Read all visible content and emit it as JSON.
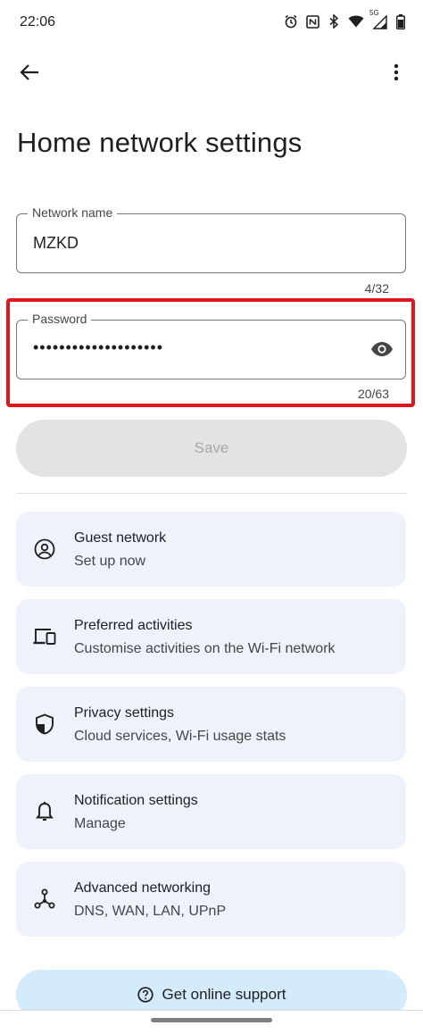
{
  "status_bar": {
    "time": "22:06",
    "icons": [
      "alarm-icon",
      "nfc-icon",
      "bluetooth-icon",
      "wifi-icon",
      "signal-icon",
      "battery-icon"
    ],
    "network_type": "5G"
  },
  "top_bar": {
    "back_icon": "arrow-back-icon",
    "more_icon": "more-vert-icon"
  },
  "page": {
    "title": "Home network settings"
  },
  "network_name": {
    "label": "Network name",
    "value": "MZKD",
    "counter": "4/32"
  },
  "password": {
    "label": "Password",
    "value": "••••••••••••••••••••",
    "counter": "20/63",
    "toggle_icon": "eye-icon"
  },
  "save": {
    "label": "Save"
  },
  "cards": [
    {
      "icon": "account-circle-icon",
      "title": "Guest network",
      "subtitle": "Set up now"
    },
    {
      "icon": "devices-icon",
      "title": "Preferred activities",
      "subtitle": "Customise activities on the Wi-Fi network"
    },
    {
      "icon": "shield-icon",
      "title": "Privacy settings",
      "subtitle": "Cloud services, Wi-Fi usage stats"
    },
    {
      "icon": "bell-icon",
      "title": "Notification settings",
      "subtitle": "Manage"
    },
    {
      "icon": "network-hub-icon",
      "title": "Advanced networking",
      "subtitle": "DNS, WAN, LAN, UPnP"
    }
  ],
  "support": {
    "icon": "help-circle-icon",
    "label": "Get online support"
  },
  "colors": {
    "highlight": "#e0181e",
    "card_bg": "#eef2fb",
    "support_bg": "#d3ebfb",
    "save_bg": "#e3e3e3"
  }
}
